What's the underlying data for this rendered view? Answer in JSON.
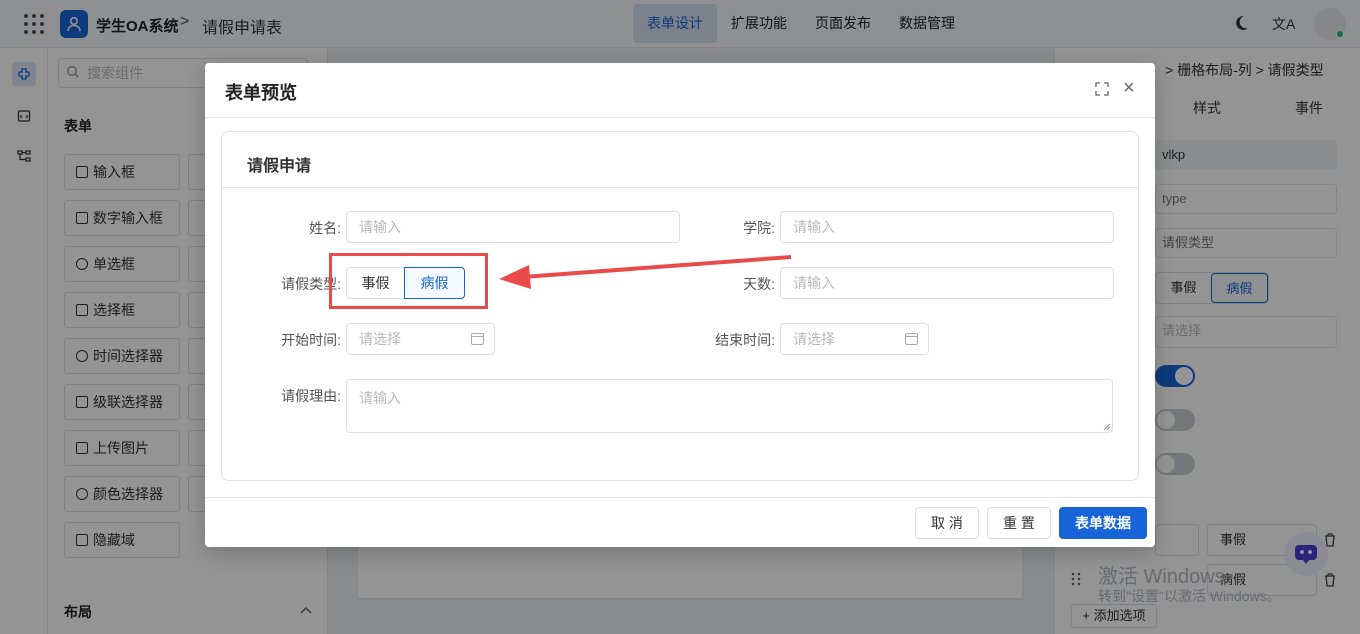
{
  "header": {
    "app_title": "学生OA系统",
    "separator": ">",
    "page_name": "请假申请表",
    "nav": [
      "表单设计",
      "扩展功能",
      "页面发布",
      "数据管理"
    ],
    "translate_icon": "文A"
  },
  "left_panel": {
    "search_placeholder": "搜索组件",
    "section_form": "表单",
    "components": [
      "输入框",
      "数字输入框",
      "单选框",
      "选择框",
      "时间选择器",
      "级联选择器",
      "上传图片",
      "颜色选择器",
      "隐藏域"
    ],
    "section_layout": "布局"
  },
  "right_panel": {
    "breadcrumb": "> 栅格布局-列 > 请假类型",
    "tabs": [
      "样式",
      "事件"
    ],
    "field_id": "vlkp",
    "field_name": "type",
    "field_label": "请假类型",
    "seg_options": [
      "事假",
      "病假"
    ],
    "select_placeholder": "请选择",
    "option_values": [
      "事假",
      "病假"
    ],
    "add_option": "+ 添加选项"
  },
  "watermark": {
    "line1": "激活 Windows",
    "line2": "转到\"设置\"以激活 Windows。"
  },
  "modal": {
    "title": "表单预览",
    "close_icon": "×",
    "card_title": "请假申请",
    "fields": {
      "name_label": "姓名:",
      "name_placeholder": "请输入",
      "college_label": "学院:",
      "college_placeholder": "请输入",
      "type_label": "请假类型:",
      "type_options": [
        "事假",
        "病假"
      ],
      "days_label": "天数:",
      "days_placeholder": "请输入",
      "start_label": "开始时间:",
      "start_placeholder": "请选择",
      "end_label": "结束时间:",
      "end_placeholder": "请选择",
      "reason_label": "请假理由:",
      "reason_placeholder": "请输入"
    },
    "buttons": {
      "cancel": "取 消",
      "reset": "重 置",
      "data": "表单数据"
    }
  },
  "colors": {
    "primary": "#1664d8",
    "highlight": "#e94b4b"
  }
}
